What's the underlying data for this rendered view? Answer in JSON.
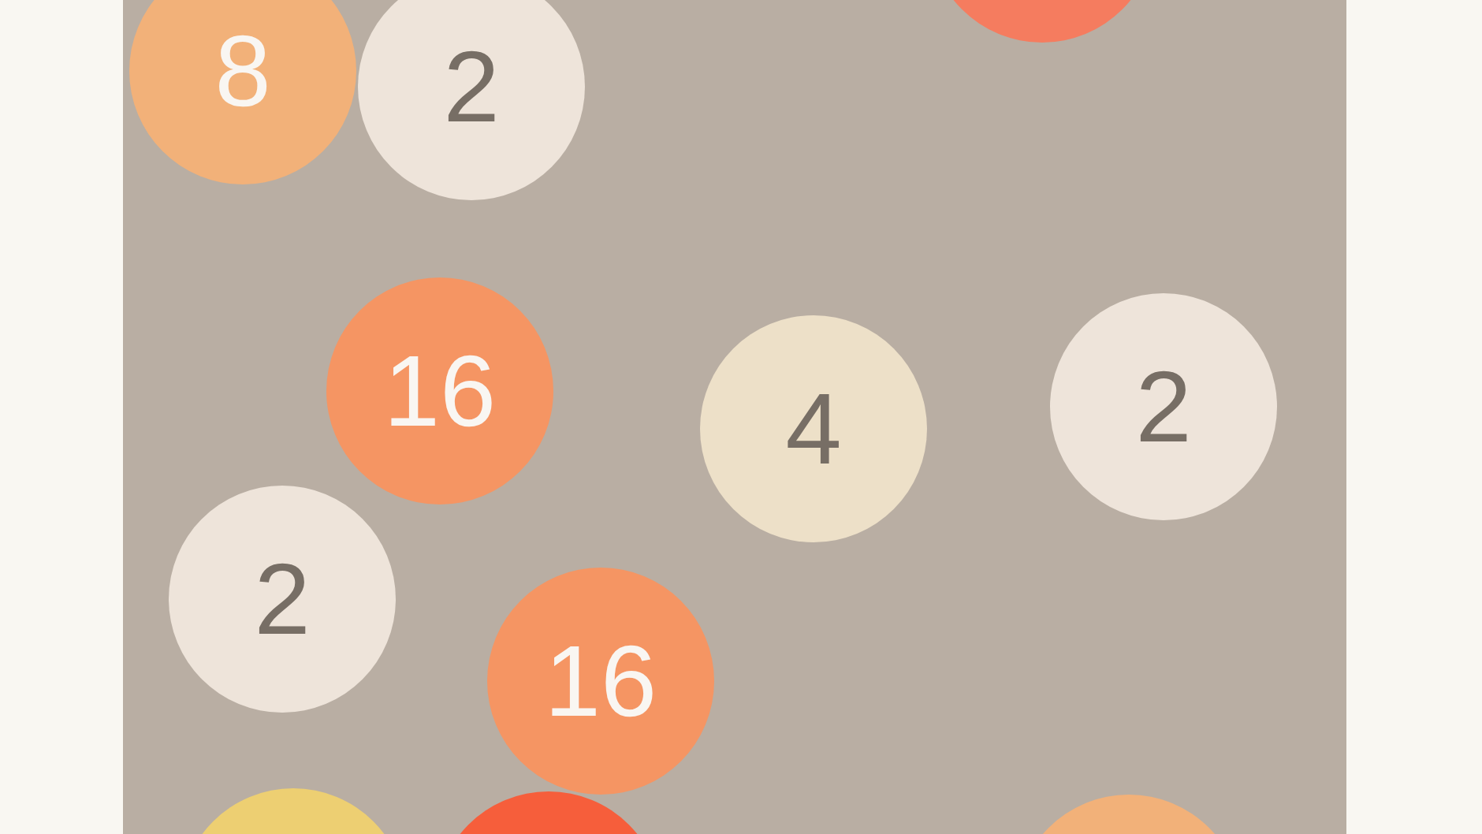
{
  "board": {
    "tiles": [
      {
        "value": "8",
        "color": "#f2b179"
      },
      {
        "value": "2",
        "color": "#eee4da"
      },
      {
        "color": "#f57c5f"
      },
      {
        "value": "16",
        "color": "#f59563"
      },
      {
        "value": "4",
        "color": "#ede0c8"
      },
      {
        "value": "2",
        "color": "#eee4da"
      },
      {
        "value": "2",
        "color": "#eee4da"
      },
      {
        "value": "16",
        "color": "#f59563"
      },
      {
        "color": "#edcf72"
      },
      {
        "color": "#f65e3b"
      },
      {
        "color": "#f2b179"
      }
    ]
  }
}
